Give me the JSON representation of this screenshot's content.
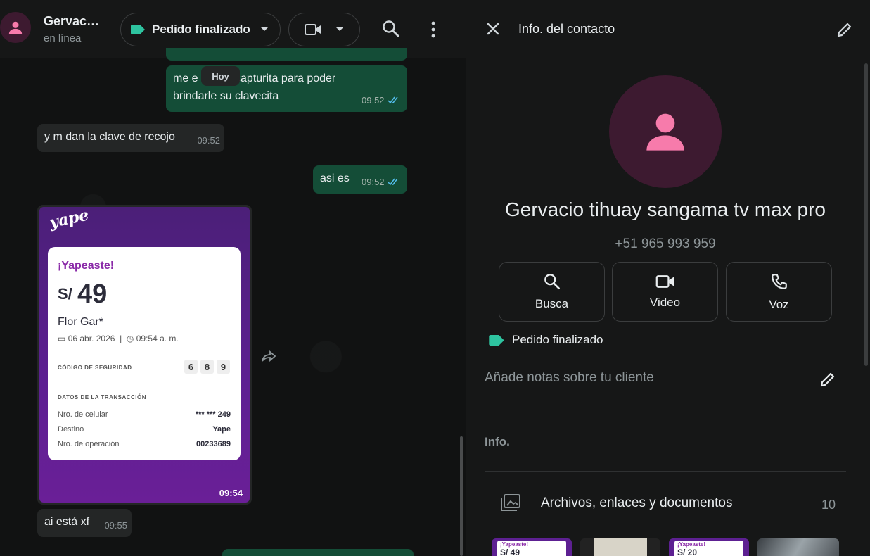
{
  "chat": {
    "contact_name": "Gervac…",
    "status": "en línea",
    "label_pill": "Pedido finalizado",
    "date_chip": "Hoy",
    "messages": [
      {
        "text1": "me e",
        "text2": "capturita para poder",
        "text3": "brindarle su clavecita",
        "time": "09:52"
      },
      {
        "text": "y m dan la clave de recojo",
        "time": "09:52"
      },
      {
        "text": "asi es",
        "time": "09:52"
      },
      {
        "text": "ai está xf",
        "time": "09:55"
      }
    ],
    "image_time": "09:54"
  },
  "yape": {
    "logo": "yape",
    "title": "¡Yapeaste!",
    "currency": "S/",
    "amount": "49",
    "recipient": "Flor Gar*",
    "date": "06 abr. 2026",
    "time": "09:54 a. m.",
    "security_label": "CÓDIGO DE SEGURIDAD",
    "codes": [
      "6",
      "8",
      "9"
    ],
    "tx_label": "DATOS DE LA TRANSACCIÓN",
    "rows": [
      {
        "k": "Nro. de celular",
        "v": "*** *** 249"
      },
      {
        "k": "Destino",
        "v": "Yape"
      },
      {
        "k": "Nro. de operación",
        "v": "00233689"
      }
    ]
  },
  "info": {
    "title": "Info. del contacto",
    "full_name": "Gervacio tihuay sangama tv max pro",
    "phone": "+51 965 993 959",
    "actions": [
      {
        "label": "Busca",
        "icon": "search-icon"
      },
      {
        "label": "Video",
        "icon": "video-icon"
      },
      {
        "label": "Voz",
        "icon": "phone-icon"
      }
    ],
    "tag": "Pedido finalizado",
    "notes_placeholder": "Añade notas sobre tu cliente",
    "section_title": "Info.",
    "files_label": "Archivos, enlaces y documentos",
    "files_count": "10",
    "thumbs": [
      {
        "title": "¡Yapeaste!",
        "amount": "S/ 49"
      },
      {
        "title": "",
        "amount": ""
      },
      {
        "title": "¡Yapeaste!",
        "amount": "S/ 20"
      },
      {
        "title": "",
        "amount": ""
      }
    ]
  },
  "colors": {
    "outgoing": "#144d37",
    "incoming": "#242626",
    "label_green": "#2ec4a0",
    "avatar_pink": "#f77bab",
    "tick_blue": "#53bdeb"
  }
}
